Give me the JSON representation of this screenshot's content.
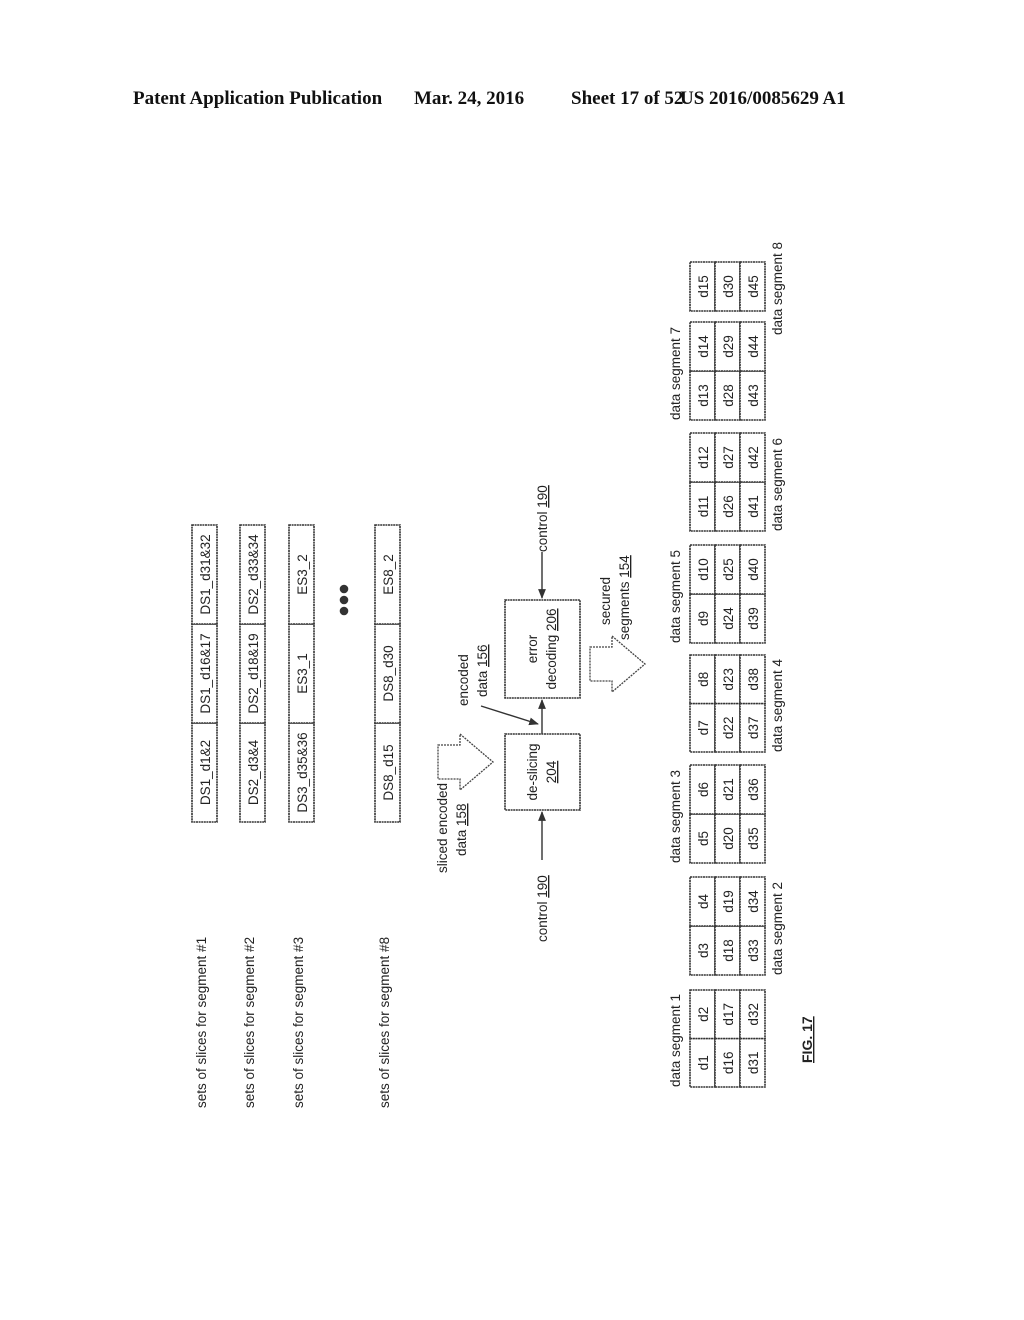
{
  "header": {
    "title": "Patent Application Publication",
    "date": "Mar. 24, 2016",
    "sheet": "Sheet 17 of 52",
    "number": "US 2016/0085629 A1"
  },
  "slice_sets": [
    {
      "label": "sets of slices for segment #1",
      "slices": [
        "DS1_d1&2",
        "DS1_d16&17",
        "DS1_d31&32"
      ]
    },
    {
      "label": "sets of slices for segment #2",
      "slices": [
        "DS2_d3&4",
        "DS2_d18&19",
        "DS2_d33&34"
      ]
    },
    {
      "label": "sets of slices for segment #3",
      "slices": [
        "DS3_d35&36",
        "ES3_1",
        "ES3_2"
      ]
    },
    {
      "label": "sets of slices for segment #8",
      "slices": [
        "DS8_d15",
        "DS8_d30",
        "ES8_2"
      ]
    }
  ],
  "ellipsis": "•••",
  "blocks": {
    "deslicing": {
      "name": "de-slicing",
      "ref": "204"
    },
    "error_decoding": {
      "name1": "error",
      "name2": "decoding",
      "ref": "206"
    }
  },
  "labels": {
    "control_left": {
      "text": "control ",
      "ref": "190"
    },
    "control_right": {
      "text": "control ",
      "ref": "190"
    },
    "sliced_encoded": {
      "line1": "sliced encoded",
      "line2": "data ",
      "ref": "158"
    },
    "encoded": {
      "line1": "encoded",
      "line2": "data ",
      "ref": "156"
    },
    "secured": {
      "line1": "secured",
      "line2": "segments ",
      "ref": "154"
    }
  },
  "data_segments": [
    {
      "label": "data segment 1",
      "rows": [
        [
          "d1",
          "d2"
        ],
        [
          "d16",
          "d17"
        ],
        [
          "d31",
          "d32"
        ]
      ]
    },
    {
      "label": "data segment 2",
      "rows": [
        [
          "d3",
          "d4"
        ],
        [
          "d18",
          "d19"
        ],
        [
          "d33",
          "d34"
        ]
      ]
    },
    {
      "label": "data segment 3",
      "rows": [
        [
          "d5",
          "d6"
        ],
        [
          "d20",
          "d21"
        ],
        [
          "d35",
          "d36"
        ]
      ]
    },
    {
      "label": "data segment 4",
      "rows": [
        [
          "d7",
          "d8"
        ],
        [
          "d22",
          "d23"
        ],
        [
          "d37",
          "d38"
        ]
      ]
    },
    {
      "label": "data segment 5",
      "rows": [
        [
          "d9",
          "d10"
        ],
        [
          "d24",
          "d25"
        ],
        [
          "d39",
          "d40"
        ]
      ]
    },
    {
      "label": "data segment 6",
      "rows": [
        [
          "d11",
          "d12"
        ],
        [
          "d26",
          "d27"
        ],
        [
          "d41",
          "d42"
        ]
      ]
    },
    {
      "label": "data segment 7",
      "rows": [
        [
          "d13",
          "d14"
        ],
        [
          "d28",
          "d29"
        ],
        [
          "d43",
          "d44"
        ]
      ]
    },
    {
      "label": "data segment 8",
      "rows": [
        [
          "d15"
        ],
        [
          "d30"
        ],
        [
          "d45"
        ]
      ]
    }
  ],
  "figure_label": "FIG. 17"
}
